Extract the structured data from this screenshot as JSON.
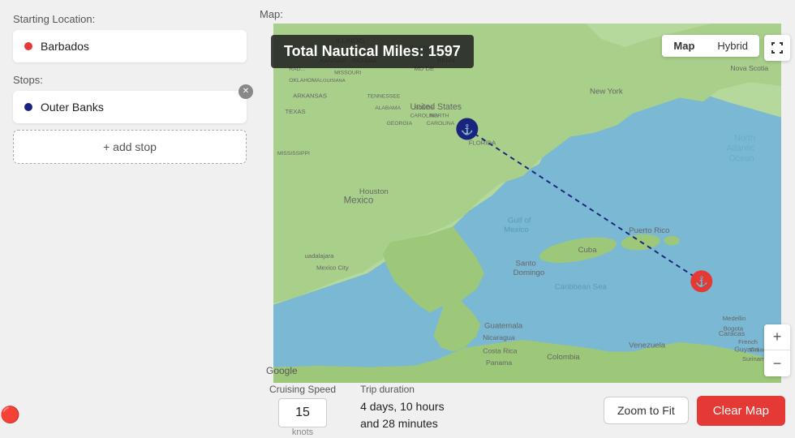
{
  "leftPanel": {
    "startingLocationLabel": "Starting Location:",
    "startingLocation": "Barbados",
    "stopsLabel": "Stops:",
    "stops": [
      {
        "name": "Outer Banks"
      }
    ],
    "addStopLabel": "+ add stop"
  },
  "bottomBar": {
    "cruisingSpeedLabel": "Cruising Speed",
    "tripDurationLabel": "Trip duration",
    "speedValue": "15",
    "knotsLabel": "knots",
    "tripDurationLine1": "4 days, 10 hours",
    "tripDurationLine2": "and 28 minutes",
    "zoomToFitLabel": "Zoom to Fit",
    "clearMapLabel": "Clear Map"
  },
  "map": {
    "label": "Map:",
    "nauticalMilesBadge": "Total Nautical Miles: 1597",
    "typeButtons": [
      "Map",
      "Hybrid"
    ],
    "activeType": "Map",
    "googleLabel": "Google",
    "zoomIn": "+",
    "zoomOut": "−"
  },
  "icons": {
    "anchor": "⚓",
    "lifesaver": "🔴",
    "fullscreen": "⛶",
    "close": "✕"
  }
}
